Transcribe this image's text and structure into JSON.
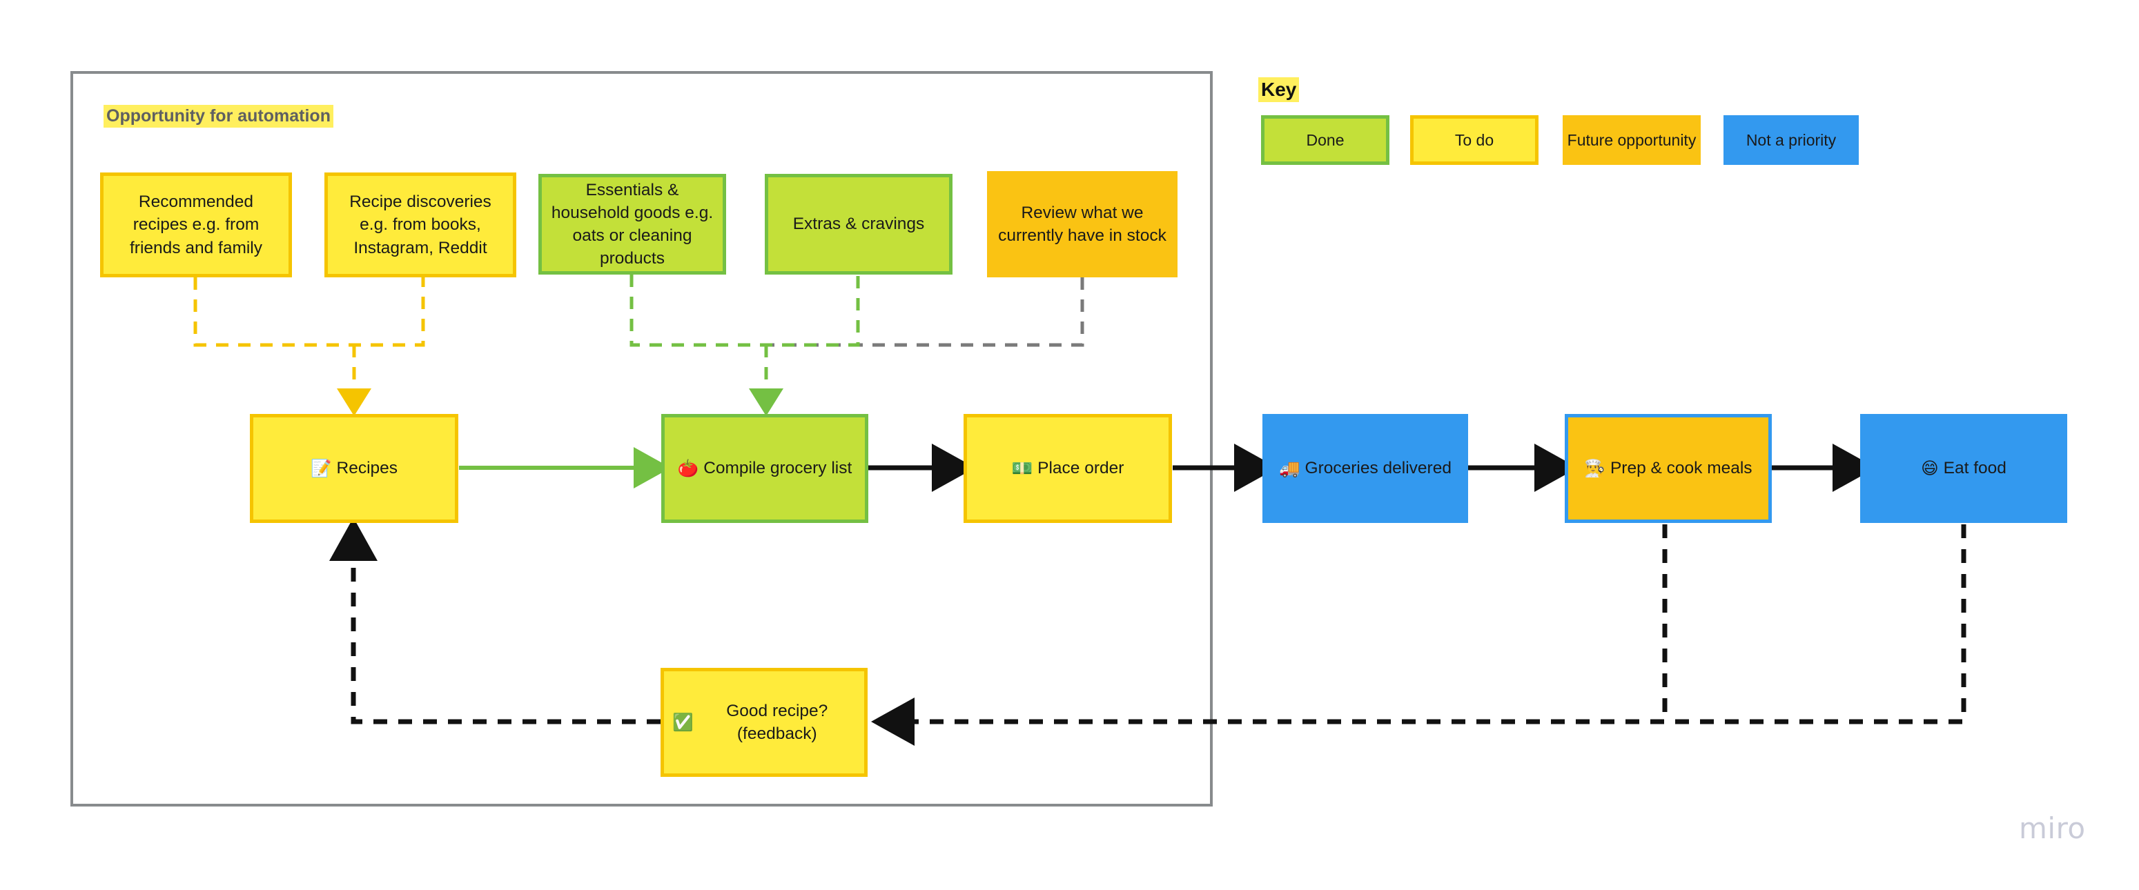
{
  "frame": {
    "label": "Opportunity for automation"
  },
  "key": {
    "title": "Key",
    "items": [
      {
        "label": "Done",
        "color": "#c3e039"
      },
      {
        "label": "To do",
        "color": "#ffeb3b"
      },
      {
        "label": "Future opportunity",
        "color": "#fac313"
      },
      {
        "label": "Not a priority",
        "color": "#3399ef"
      }
    ]
  },
  "inputs": [
    {
      "id": "recommended",
      "label": "Recommended recipes e.g. from friends and family"
    },
    {
      "id": "discoveries",
      "label": "Recipe discoveries e.g. from books, Instagram, Reddit"
    },
    {
      "id": "essentials",
      "label": "Essentials & household goods e.g. oats or cleaning products"
    },
    {
      "id": "extras",
      "label": "Extras & cravings"
    },
    {
      "id": "stock",
      "label": "Review what we currently have in stock"
    }
  ],
  "flow": [
    {
      "id": "recipes",
      "emoji": "📝",
      "label": "Recipes"
    },
    {
      "id": "compile",
      "emoji": "🍅",
      "label": "Compile grocery list"
    },
    {
      "id": "order",
      "emoji": "💵",
      "label": "Place order"
    },
    {
      "id": "delivered",
      "emoji": "🚚",
      "label": "Groceries delivered"
    },
    {
      "id": "cook",
      "emoji": "👨‍🍳",
      "label": "Prep & cook meals"
    },
    {
      "id": "eat",
      "emoji": "😄",
      "label": "Eat food"
    }
  ],
  "feedback": {
    "emoji": "✅",
    "label": "Good recipe? (feedback)"
  },
  "watermark": "miro",
  "colors": {
    "yellow_fill": "#ffeb3b",
    "yellow_border": "#f5c400",
    "green_fill": "#c3e039",
    "green_border": "#74c043",
    "orange_fill": "#fac313",
    "blue_fill": "#3399ef",
    "frame_border": "#888b8d",
    "wire_black": "#111111",
    "wire_gray": "#7a7a7a",
    "wire_green": "#74c043",
    "wire_yellow": "#f5c400",
    "highlight": "#ffef5e"
  }
}
